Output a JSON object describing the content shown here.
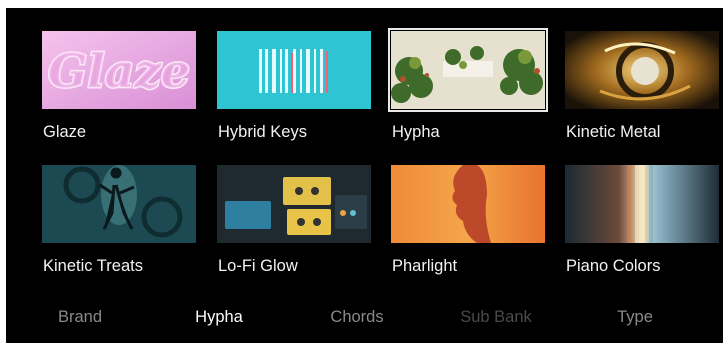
{
  "presets": [
    {
      "name": "Glaze",
      "art": "pink-chrome-lettering",
      "selected": false
    },
    {
      "name": "Hybrid Keys",
      "art": "cyan-piano-strings",
      "selected": false
    },
    {
      "name": "Hypha",
      "art": "piano-with-foliage",
      "selected": true
    },
    {
      "name": "Kinetic Metal",
      "art": "gold-mechanical-swirl",
      "selected": false
    },
    {
      "name": "Kinetic Treats",
      "art": "teal-dancer-gears",
      "selected": false
    },
    {
      "name": "Lo-Fi Glow",
      "art": "cassettes-and-gear",
      "selected": false
    },
    {
      "name": "Pharlight",
      "art": "orange-silhouette-profile",
      "selected": false
    },
    {
      "name": "Piano Colors",
      "art": "prismatic-light-beam",
      "selected": false
    }
  ],
  "glaze_art_text": "Glaze",
  "filter_tabs": [
    {
      "label": "Brand",
      "state": "inactive"
    },
    {
      "label": "Hypha",
      "state": "active"
    },
    {
      "label": "Chords",
      "state": "inactive"
    },
    {
      "label": "Sub Bank",
      "state": "disabled"
    },
    {
      "label": "Type",
      "state": "inactive"
    }
  ],
  "colors": {
    "background": "#000000",
    "label": "#f2f2f2",
    "tab_active": "#ffffff",
    "tab_inactive": "#8a8a8a",
    "tab_disabled": "#4a4a4a",
    "selection": "#e8e8e8"
  }
}
